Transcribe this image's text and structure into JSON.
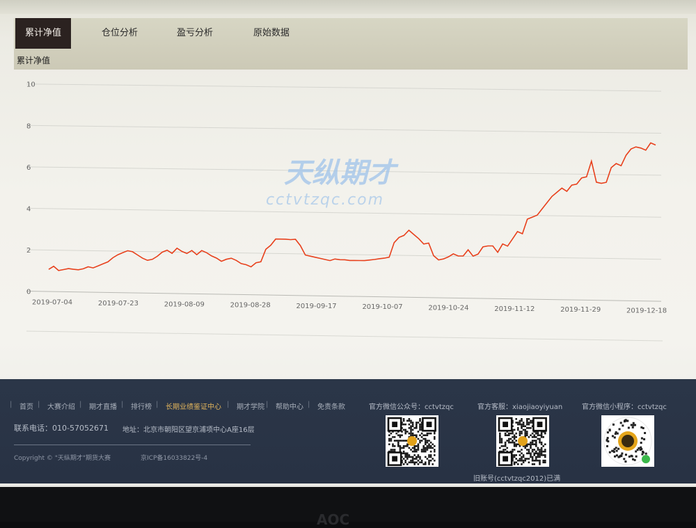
{
  "tabs": [
    {
      "label": "累计净值",
      "active": true
    },
    {
      "label": "仓位分析",
      "active": false
    },
    {
      "label": "盈亏分析",
      "active": false
    },
    {
      "label": "原始数据",
      "active": false
    }
  ],
  "section_title": "累计净值",
  "watermark": {
    "title": "天纵期才",
    "url": "cctvtzqc.com"
  },
  "chart_data": {
    "type": "line",
    "title": "",
    "xlabel": "",
    "ylabel": "",
    "ylim": [
      0,
      10
    ],
    "yticks": [
      0,
      2,
      4,
      6,
      8,
      10
    ],
    "xticks": [
      "2019-07-04",
      "2019-07-23",
      "2019-08-09",
      "2019-08-28",
      "2019-09-17",
      "2019-10-07",
      "2019-10-24",
      "2019-11-12",
      "2019-11-29",
      "2019-12-18"
    ],
    "line_color": "#e8401c",
    "grid": true,
    "series": [
      {
        "values": [
          1.1,
          1.25,
          1.05,
          1.1,
          1.15,
          1.12,
          1.1,
          1.15,
          1.25,
          1.2,
          1.3,
          1.4,
          1.5,
          1.7,
          1.85,
          1.95,
          2.05,
          2.0,
          1.85,
          1.7,
          1.6,
          1.65,
          1.8,
          2.0,
          2.1,
          1.95,
          2.2,
          2.05,
          1.95,
          2.1,
          1.9,
          2.1,
          2.0,
          1.85,
          1.75,
          1.6,
          1.7,
          1.75,
          1.65,
          1.5,
          1.45,
          1.35,
          1.55,
          1.6,
          2.2,
          2.4,
          2.7,
          2.7,
          2.7,
          2.68,
          2.7,
          2.4,
          1.95,
          1.9,
          1.85,
          1.8,
          1.75,
          1.7,
          1.78,
          1.75,
          1.75,
          1.72,
          1.72,
          1.72,
          1.72,
          1.75,
          1.78,
          1.82,
          1.85,
          1.9,
          2.6,
          2.85,
          2.95,
          3.2,
          3.0,
          2.8,
          2.55,
          2.6,
          2.0,
          1.8,
          1.85,
          1.95,
          2.1,
          2.0,
          2.0,
          2.3,
          2.0,
          2.1,
          2.45,
          2.5,
          2.5,
          2.2,
          2.6,
          2.5,
          2.85,
          3.2,
          3.1,
          3.8,
          3.9,
          4.0,
          4.3,
          4.6,
          4.9,
          5.1,
          5.3,
          5.15,
          5.45,
          5.5,
          5.8,
          5.85,
          6.6,
          5.6,
          5.55,
          5.6,
          6.3,
          6.5,
          6.4,
          6.9,
          7.2,
          7.3,
          7.25,
          7.15,
          7.5,
          7.4
        ]
      }
    ]
  },
  "footer": {
    "nav": [
      "首页",
      "大赛介绍",
      "期才直播",
      "排行榜",
      "长期业绩鉴证中心",
      "期才学院",
      "帮助中心",
      "免责条款"
    ],
    "highlight_index": 4,
    "wechat_official": "官方微信公众号：cctvtzqc",
    "service": "官方客服：xiaojiaoyiyuan",
    "miniprogram": "官方微信小程序：cctvtzqc",
    "phone": "联系电话：010-57052671",
    "address": "地址：北京市朝阳区望京浦项中心A座16层",
    "copyright": "Copyright © \"天纵期才\"期货大赛",
    "icp": "京ICP备16033822号-4",
    "old_account": "旧账号(cctvtzqc2012)已满"
  },
  "bezel_brand": "AOC"
}
